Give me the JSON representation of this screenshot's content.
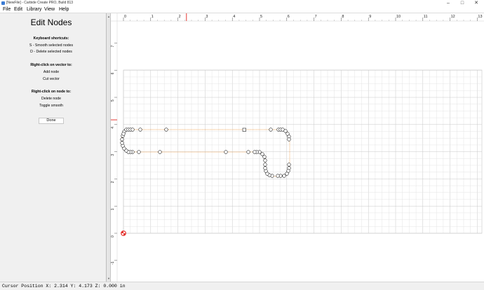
{
  "window": {
    "title": "[NewFile] - Carbide Create PRO, Build 813",
    "minimize_icon": "minimize-icon",
    "maximize_icon": "maximize-icon",
    "close_icon": "close-icon"
  },
  "menu": {
    "file": "File",
    "edit": "Edit",
    "library": "Library",
    "view": "View",
    "help": "Help"
  },
  "panel": {
    "title": "Edit Nodes",
    "keyboard_heading": "Keyboard shortcuts:",
    "shortcut_smooth": "S - Smooth selected nodes",
    "shortcut_delete": "D - Delete selected nodes",
    "vector_heading": "Right-click on vector to:",
    "vector_add_node": "Add node",
    "vector_cut": "Cut vector",
    "node_heading": "Right-click on node to:",
    "node_delete": "Delete node",
    "node_toggle": "Toggle smooth",
    "done_button": "Done"
  },
  "ruler": {
    "x_ticks": [
      "0",
      "1",
      "2",
      "3",
      "4",
      "5",
      "6",
      "7",
      "8",
      "9",
      "10",
      "11",
      "12",
      "13"
    ],
    "y_ticks": [
      "7",
      "6",
      "5",
      "4",
      "3",
      "2",
      "1",
      "0",
      "-1"
    ]
  },
  "cursor": {
    "x": 2.314,
    "y": 4.173
  },
  "colors": {
    "grid_minor": "#e4e4e4",
    "grid_major": "#c8c8c8",
    "path": "#f2a65a",
    "cursor_marker": "#e53935",
    "origin": "#e53935"
  },
  "status": {
    "text": "Cursor Position X: 2.314 Y: 4.173 Z: 0.000 in"
  }
}
